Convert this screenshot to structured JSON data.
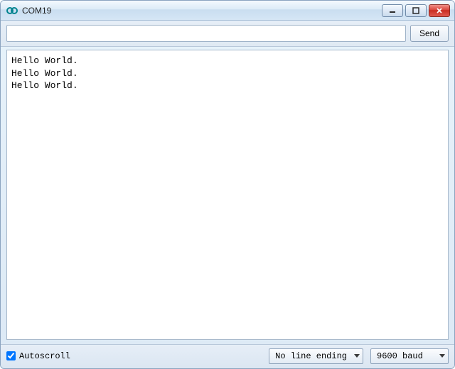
{
  "window": {
    "title": "COM19"
  },
  "toolbar": {
    "input_value": "",
    "input_placeholder": "",
    "send_label": "Send"
  },
  "console": {
    "lines": [
      "Hello World.",
      "Hello World.",
      "Hello World."
    ]
  },
  "bottom": {
    "autoscroll_label": "Autoscroll",
    "autoscroll_checked": true,
    "line_ending_selected": "No line ending",
    "baud_selected": "9600 baud"
  },
  "icons": {
    "app": "arduino-icon",
    "minimize": "minimize-icon",
    "maximize": "maximize-icon",
    "close": "close-icon",
    "dropdown": "chevron-down-icon"
  }
}
